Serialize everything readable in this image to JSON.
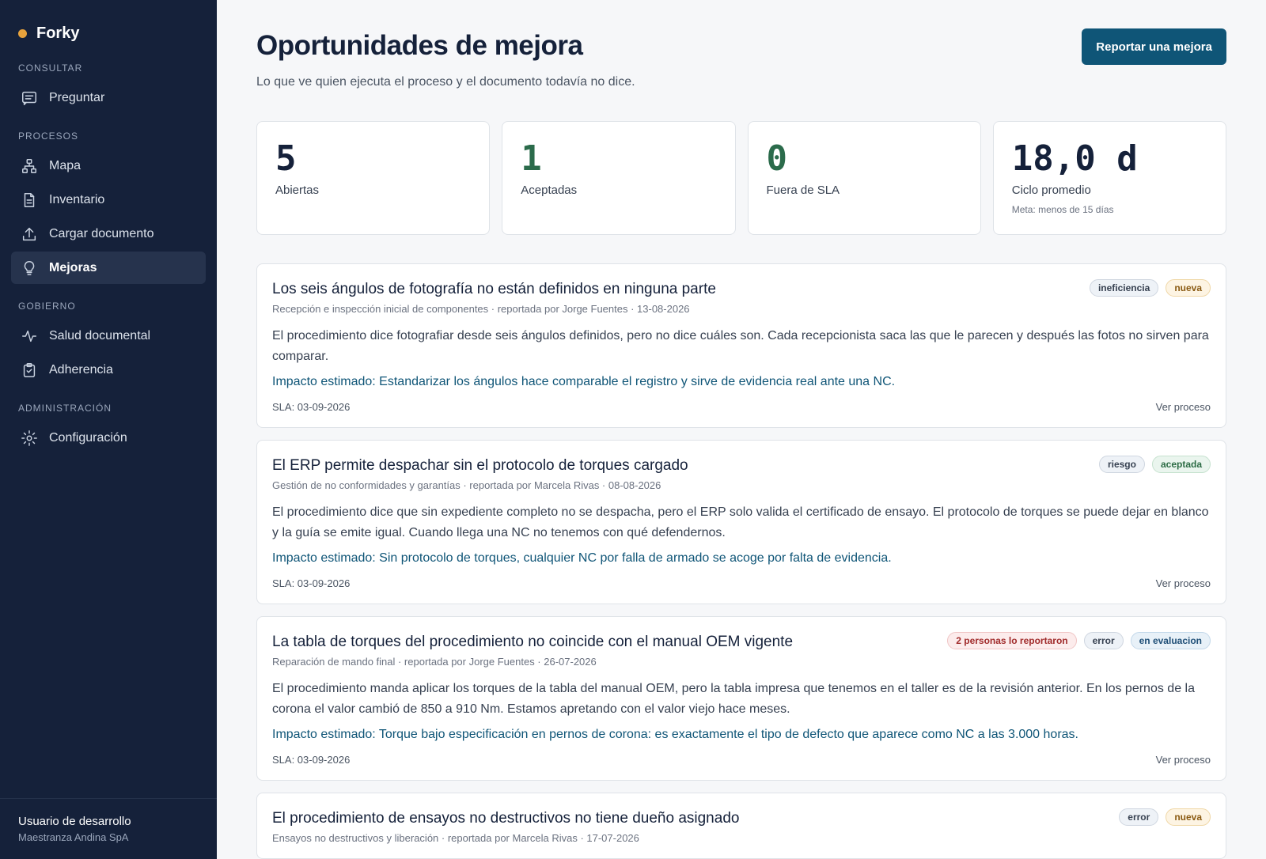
{
  "app": {
    "name": "Forky"
  },
  "sidebar": {
    "sections": [
      {
        "title": "CONSULTAR",
        "items": [
          {
            "label": "Preguntar",
            "icon": "chat-icon"
          }
        ]
      },
      {
        "title": "PROCESOS",
        "items": [
          {
            "label": "Mapa",
            "icon": "sitemap-icon"
          },
          {
            "label": "Inventario",
            "icon": "document-icon"
          },
          {
            "label": "Cargar documento",
            "icon": "upload-icon"
          },
          {
            "label": "Mejoras",
            "icon": "lightbulb-icon",
            "active": true
          }
        ]
      },
      {
        "title": "GOBIERNO",
        "items": [
          {
            "label": "Salud documental",
            "icon": "pulse-icon"
          },
          {
            "label": "Adherencia",
            "icon": "clipboard-check-icon"
          }
        ]
      },
      {
        "title": "ADMINISTRACIÓN",
        "items": [
          {
            "label": "Configuración",
            "icon": "gear-icon"
          }
        ]
      }
    ],
    "user": {
      "name": "Usuario de desarrollo",
      "org": "Maestranza Andina SpA"
    }
  },
  "header": {
    "title": "Oportunidades de mejora",
    "subtitle": "Lo que ve quien ejecuta el proceso y el documento todavía no dice.",
    "report_button": "Reportar una mejora"
  },
  "stats": [
    {
      "value": "5",
      "label": "Abiertas",
      "color": "#15213a"
    },
    {
      "value": "1",
      "label": "Aceptadas",
      "color": "#2b6b4b"
    },
    {
      "value": "0",
      "label": "Fuera de SLA",
      "color": "#2b6b4b"
    },
    {
      "value": "18,0 d",
      "label": "Ciclo promedio",
      "note": "Meta: menos de 15 días",
      "color": "#15213a"
    }
  ],
  "colors": {
    "accent": "#0f5577",
    "sidebar": "#15213a",
    "brand_dot": "#e8a33d"
  },
  "improvements": [
    {
      "title": "Los seis ángulos de fotografía no están definidos en ninguna parte",
      "meta": "Recepción e inspección inicial de componentes · reportada por Jorge Fuentes · 13-08-2026",
      "badges": [
        {
          "text": "ineficiencia",
          "kind": "type"
        },
        {
          "text": "nueva",
          "kind": "nueva"
        }
      ],
      "description": "El procedimiento dice fotografiar desde seis ángulos definidos, pero no dice cuáles son. Cada recepcionista saca las que le parecen y después las fotos no sirven para comparar.",
      "impact": "Impacto estimado: Estandarizar los ángulos hace comparable el registro y sirve de evidencia real ante una NC.",
      "sla": "SLA: 03-09-2026",
      "link": "Ver proceso"
    },
    {
      "title": "El ERP permite despachar sin el protocolo de torques cargado",
      "meta": "Gestión de no conformidades y garantías · reportada por Marcela Rivas · 08-08-2026",
      "badges": [
        {
          "text": "riesgo",
          "kind": "type"
        },
        {
          "text": "aceptada",
          "kind": "aceptada"
        }
      ],
      "description": "El procedimiento dice que sin expediente completo no se despacha, pero el ERP solo valida el certificado de ensayo. El protocolo de torques se puede dejar en blanco y la guía se emite igual. Cuando llega una NC no tenemos con qué defendernos.",
      "impact": "Impacto estimado: Sin protocolo de torques, cualquier NC por falla de armado se acoge por falta de evidencia.",
      "sla": "SLA: 03-09-2026",
      "link": "Ver proceso"
    },
    {
      "title": "La tabla de torques del procedimiento no coincide con el manual OEM vigente",
      "meta": "Reparación de mando final · reportada por Jorge Fuentes · 26-07-2026",
      "badges": [
        {
          "text": "2 personas lo reportaron",
          "kind": "alert"
        },
        {
          "text": "error",
          "kind": "type"
        },
        {
          "text": "en evaluacion",
          "kind": "evaluacion"
        }
      ],
      "description": "El procedimiento manda aplicar los torques de la tabla del manual OEM, pero la tabla impresa que tenemos en el taller es de la revisión anterior. En los pernos de la corona el valor cambió de 850 a 910 Nm. Estamos apretando con el valor viejo hace meses.",
      "impact": "Impacto estimado: Torque bajo especificación en pernos de corona: es exactamente el tipo de defecto que aparece como NC a las 3.000 horas.",
      "sla": "SLA: 03-09-2026",
      "link": "Ver proceso"
    },
    {
      "title": "El procedimiento de ensayos no destructivos no tiene dueño asignado",
      "meta": "Ensayos no destructivos y liberación · reportada por Marcela Rivas · 17-07-2026",
      "badges": [
        {
          "text": "error",
          "kind": "type"
        },
        {
          "text": "nueva",
          "kind": "nueva"
        }
      ],
      "description": "",
      "impact": "",
      "sla": "",
      "link": ""
    }
  ]
}
